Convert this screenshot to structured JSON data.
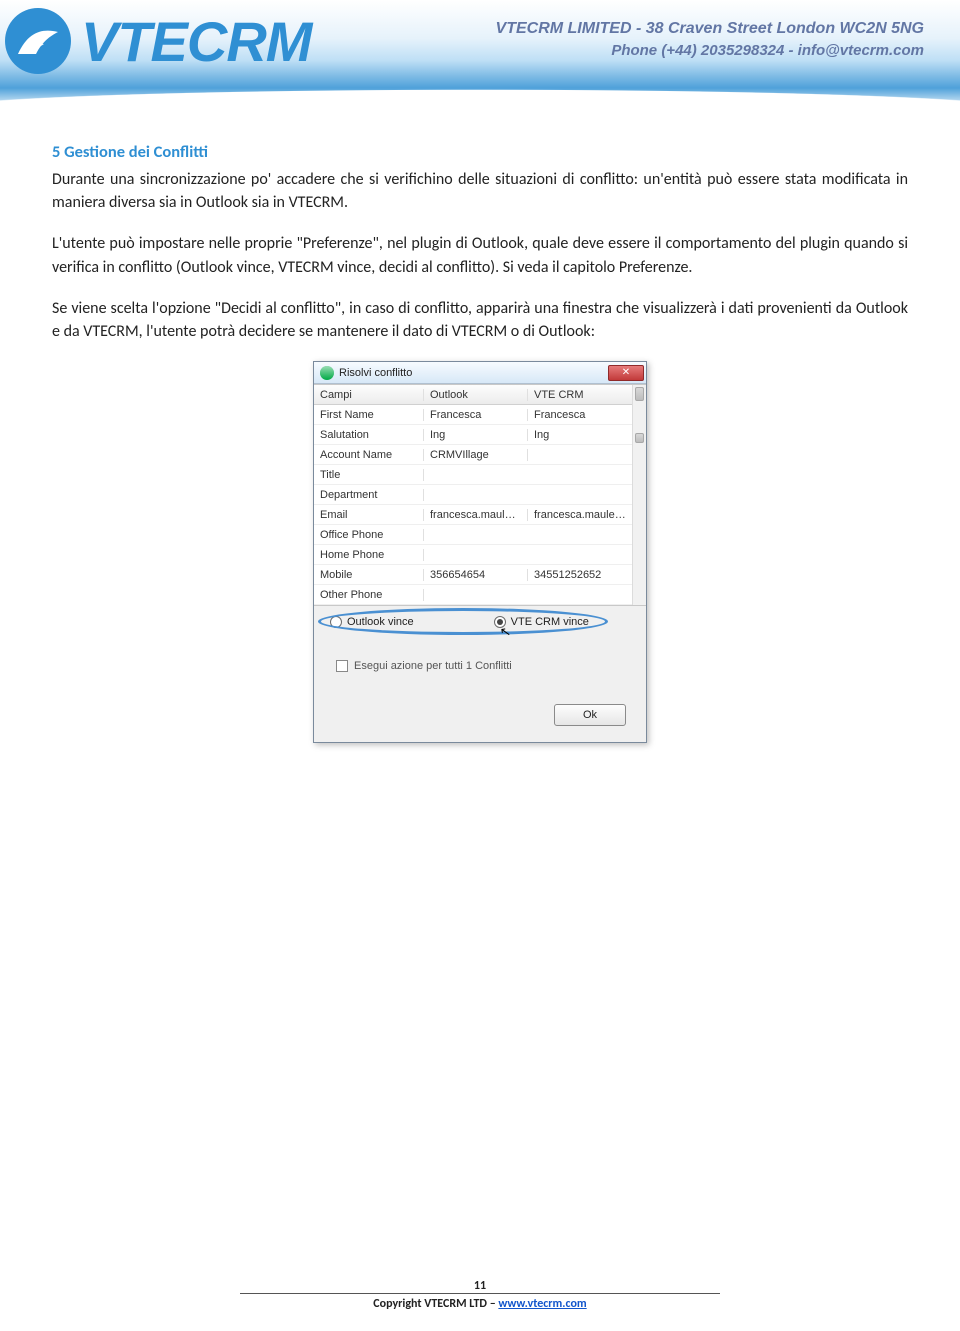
{
  "header": {
    "logo_text": "VTECRM",
    "address": "VTECRM LIMITED - 38 Craven Street London WC2N 5NG",
    "contact": "Phone (+44) 2035298324 - info@vtecrm.com"
  },
  "content": {
    "section_title": "5 Gestione dei Conflitti",
    "p1": "Durante una sincronizzazione po' accadere che si verifichino delle situazioni di conflitto: un'entità può essere stata modificata in maniera diversa sia in Outlook sia in VTECRM.",
    "p2": "L'utente può impostare nelle proprie \"Preferenze\", nel plugin di Outlook, quale deve essere il comportamento del plugin quando si verifica in conflitto (Outlook vince, VTECRM vince, decidi al conflitto). Si veda il capitolo Preferenze.",
    "p3": "Se viene scelta l'opzione \"Decidi al conflitto\", in caso di conflitto, apparirà una finestra che visualizzerà i dati provenienti da Outlook e da VTECRM,  l'utente potrà decidere se mantenere il dato di VTECRM o di Outlook:"
  },
  "dialog": {
    "title": "Risolvi conflitto",
    "close_label": "✕",
    "columns": {
      "c0": "Campi",
      "c1": "Outlook",
      "c2": "VTE CRM"
    },
    "rows": [
      {
        "c0": "First Name",
        "c1": "Francesca",
        "c2": "Francesca"
      },
      {
        "c0": "Salutation",
        "c1": "Ing",
        "c2": "Ing"
      },
      {
        "c0": "Account Name",
        "c1": "CRMVIllage",
        "c2": ""
      },
      {
        "c0": "Title",
        "c1": "",
        "c2": ""
      },
      {
        "c0": "Department",
        "c1": "",
        "c2": ""
      },
      {
        "c0": "Email",
        "c1": "francesca.maule@cr...",
        "c2": "francesca.maule@cr..."
      },
      {
        "c0": "Office Phone",
        "c1": "",
        "c2": ""
      },
      {
        "c0": "Home Phone",
        "c1": "",
        "c2": ""
      },
      {
        "c0": "Mobile",
        "c1": "356654654",
        "c2": "34551252652"
      },
      {
        "c0": "Other Phone",
        "c1": "",
        "c2": ""
      }
    ],
    "radio_outlook": "Outlook vince",
    "radio_vte": "VTE CRM vince",
    "checkbox_label": "Esegui azione per tutti 1 Conflitti",
    "ok_label": "Ok"
  },
  "footer": {
    "page_number": "11",
    "copyright_prefix": "Copyright VTECRM LTD – ",
    "link_text": "www.vtecrm.com"
  }
}
